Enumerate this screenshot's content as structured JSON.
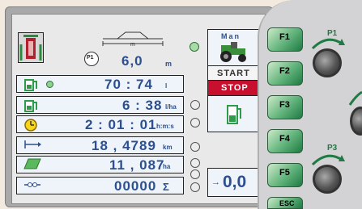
{
  "top_row": {
    "p1_badge": "P1",
    "value": "6,0",
    "unit": "m",
    "boom_unit": "m"
  },
  "rows": [
    {
      "value": "70 : 74",
      "unit": "l"
    },
    {
      "value": "6 : 38",
      "unit": "l/ha"
    },
    {
      "value": "2 : 01 : 01",
      "unit": "h:m:s"
    },
    {
      "value": "18 , 4789",
      "unit": "km"
    },
    {
      "value": "11 , 087",
      "unit": "ha"
    },
    {
      "value": "00000",
      "unit": "Σ"
    }
  ],
  "mode": {
    "man_label": "Man",
    "start_label": "START",
    "stop_label": "STOP"
  },
  "bottom_readout": {
    "value": "0,0"
  },
  "function_buttons": [
    "F1",
    "F2",
    "F3",
    "F4",
    "F5",
    "ESC"
  ],
  "knob_labels": {
    "p1": "P1",
    "p3": "P3"
  },
  "colors": {
    "stop_bg": "#c8102e",
    "lcd_text": "#2c4f8f",
    "tank_green": "#2e9b4a",
    "tractor_green": "#3a8f3a"
  },
  "icons": {
    "sprayer": "sprayer-icon",
    "tank": "tank-icon",
    "clock": "clock-icon",
    "distance": "distance-arrow-icon",
    "area": "area-icon",
    "counter": "counter-icon",
    "tractor": "tractor-icon"
  }
}
